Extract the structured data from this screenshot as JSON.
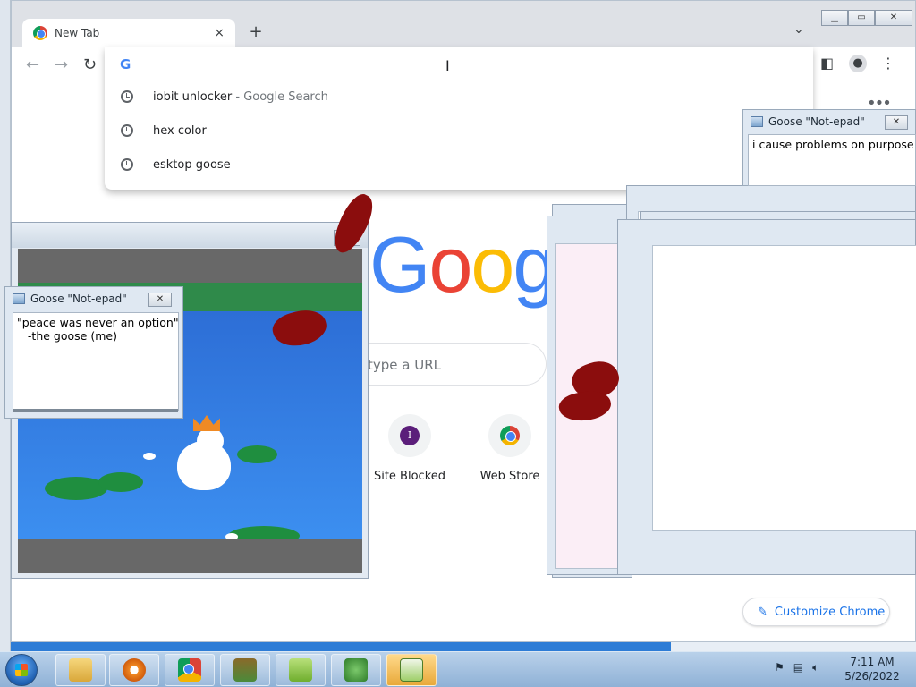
{
  "browser": {
    "tab_title": "New Tab",
    "tab_close": "×",
    "new_tab": "+",
    "tab_search": "⌄",
    "omnibox": {
      "g_label": "G",
      "suggestions": [
        {
          "text": "iobit unlocker",
          "sub": " - Google Search"
        },
        {
          "text": "hex color",
          "sub": ""
        },
        {
          "text": "esktop goose",
          "sub": ""
        }
      ]
    },
    "ntp": {
      "logo": "Googl",
      "search_placeholder": "type a URL",
      "shortcuts": [
        {
          "label": "Site Blocked",
          "icon_letter": "I"
        },
        {
          "label": "Web Store"
        }
      ],
      "customize_label": "Customize Chrome"
    }
  },
  "notes": [
    {
      "title": "Goose \"Not-epad\"",
      "body": "i cause problems on purpose"
    },
    {
      "title": "Goose \"Not-epad\"",
      "body": "\"peace was never an option\"\n   -the goose (me)"
    }
  ],
  "taskbar": {
    "time": "7:11 AM",
    "date": "5/26/2022"
  },
  "colors": {
    "google_blue": "#4285f4",
    "google_red": "#ea4335",
    "google_yellow": "#fbbc05",
    "google_green": "#34a853",
    "mud": "#8b0d0d",
    "link_blue": "#1a73e8"
  }
}
